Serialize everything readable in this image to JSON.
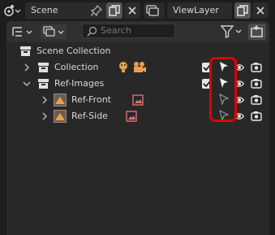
{
  "topbar": {
    "scene_label": "Scene",
    "viewlayer_label": "ViewLayer"
  },
  "header": {
    "search_placeholder": "Search"
  },
  "tree": {
    "root_label": "Scene Collection",
    "items": [
      {
        "label": "Collection",
        "expanded": false
      },
      {
        "label": "Ref-Images",
        "expanded": true
      },
      {
        "label": "Ref-Front",
        "expanded": false
      },
      {
        "label": "Ref-Side",
        "expanded": false
      }
    ]
  },
  "colors": {
    "background": "#1d1d1d",
    "panel": "#282828",
    "highlight_box": "#e00000",
    "image_icon": "#e07070",
    "light_icon": "#e8a050"
  }
}
